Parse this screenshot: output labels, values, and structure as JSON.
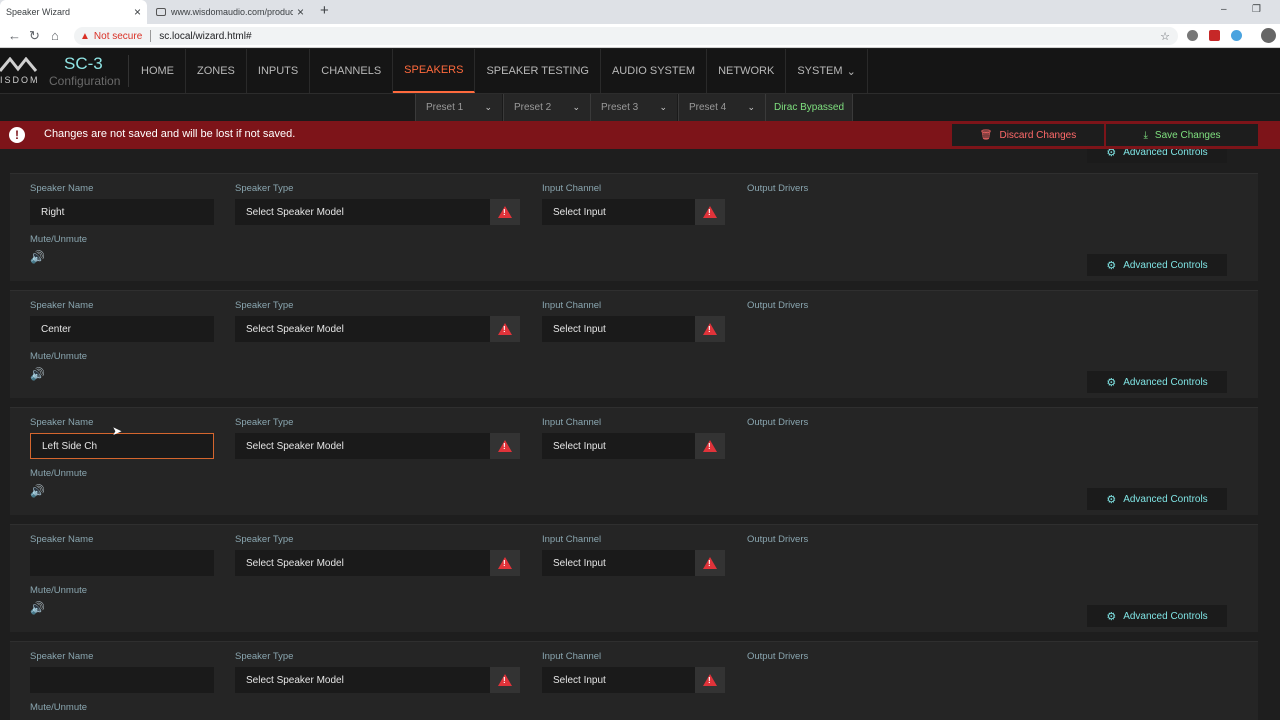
{
  "browser": {
    "tabs": [
      {
        "title": "Speaker Wizard",
        "close": "×"
      },
      {
        "title": "www.wisdomaudio.com/product",
        "close": "×"
      }
    ],
    "new_tab": "+",
    "window_controls": {
      "minimize": "–",
      "restore": "❐"
    },
    "security_icon": "▲",
    "security_label": "Not secure",
    "url": "sc.local/wizard.html#",
    "bookmark_icon": "☆"
  },
  "app": {
    "logo_text": "ISDOM",
    "product": "SC-3",
    "product_sub": "Configuration",
    "nav": [
      "HOME",
      "ZONES",
      "INPUTS",
      "CHANNELS",
      "SPEAKERS",
      "SPEAKER TESTING",
      "AUDIO SYSTEM",
      "NETWORK",
      "SYSTEM"
    ],
    "nav_system_chevron": "⌄",
    "presets": [
      "Preset 1",
      "Preset 2",
      "Preset 3",
      "Preset 4"
    ],
    "preset_chevron": "⌄",
    "dirac": "Dirac Bypassed"
  },
  "alert": {
    "icon": "!",
    "message": "Changes are not saved and will be lost if not saved.",
    "discard": "Discard Changes",
    "save": "Save Changes"
  },
  "labels": {
    "speaker_name": "Speaker Name",
    "speaker_type": "Speaker Type",
    "input_channel": "Input Channel",
    "output_drivers": "Output Drivers",
    "mute": "Mute/Unmute",
    "advanced": "Advanced Controls",
    "speaker_model": "Select Speaker Model",
    "select_input": "Select Input",
    "mute_icon": "🔊"
  },
  "speakers": [
    {
      "name": "Right"
    },
    {
      "name": "Center"
    },
    {
      "name": "Left Side Ch"
    },
    {
      "name": ""
    },
    {
      "name": ""
    }
  ],
  "colors": {
    "accent": "#ff6a3d",
    "teal": "#8fe3e3",
    "alert": "#7d1419",
    "green": "#7fe07f",
    "warn": "#e0333a"
  }
}
